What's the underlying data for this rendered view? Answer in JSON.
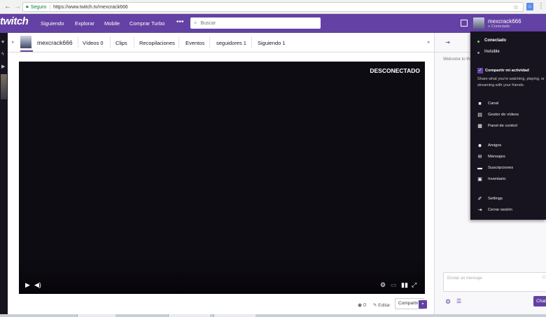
{
  "browser": {
    "back": "←",
    "forward": "→",
    "reload": "C",
    "secure_label": "Seguro",
    "url": "https://www.twitch.tv/mexcrack666"
  },
  "topnav": {
    "logo": "twitch",
    "links": [
      "Siguiendo",
      "Explorar",
      "Mobile",
      "Comprar Turbo"
    ],
    "more": "•••",
    "search_placeholder": "Buscar",
    "username": "mexcrack666",
    "status": "Conectado"
  },
  "channel": {
    "name": "mexcrack666",
    "tabs": [
      "Vídeos 0",
      "Clips",
      "Recopilaciones",
      "Eventos",
      "seguidores 1",
      "Siguiendo 1"
    ]
  },
  "player": {
    "status": "DESCONECTADO"
  },
  "under_player": {
    "views": "0",
    "edit": "Editar",
    "share": "Compartir"
  },
  "chat": {
    "welcome": "Welcome to the chat room!",
    "input_placeholder": "Enviar un mensaje",
    "chat_button": "Chat"
  },
  "dropdown": {
    "status_online": "Conectado",
    "status_invisible": "Invisible",
    "share_activity_title": "Compartir mi actividad",
    "share_activity_desc": "Share what you're watching, playing, or streaming with your friends.",
    "items_group1": [
      "Canal",
      "Gestor de vídeos",
      "Panel de control"
    ],
    "items_group2": [
      "Amigos",
      "Mensajes",
      "Suscripciones",
      "Inventario"
    ],
    "items_group3": [
      "Settings",
      "Cerrar sesión"
    ]
  },
  "colors": {
    "brand": "#6441a4",
    "dark": "#17141f",
    "online": "#6ed36e"
  }
}
